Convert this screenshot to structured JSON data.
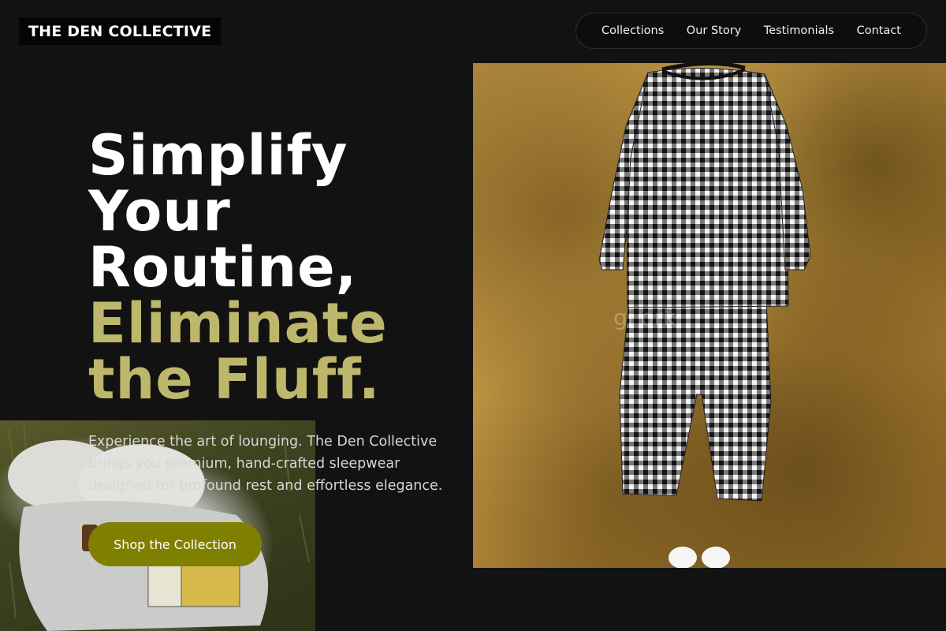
{
  "brand": {
    "name": "THE DEN COLLECTIVE"
  },
  "nav": {
    "items": [
      {
        "label": "Collections"
      },
      {
        "label": "Our Story"
      },
      {
        "label": "Testimonials"
      },
      {
        "label": "Contact"
      }
    ]
  },
  "hero": {
    "headline_lines": [
      "Simplify",
      "Your",
      "Routine,"
    ],
    "accent_lines": [
      "Eliminate",
      "the Fluff."
    ],
    "description": "Experience the art of lounging. The Den Collective brings you premium, hand-crafted sleepwear designed for profound rest and effortless elegance.",
    "cta_label": "Shop the Collection",
    "image_watermark": "gi          ork"
  },
  "colors": {
    "background": "#121212",
    "accent": "#bdb76b",
    "cta": "#808000"
  }
}
